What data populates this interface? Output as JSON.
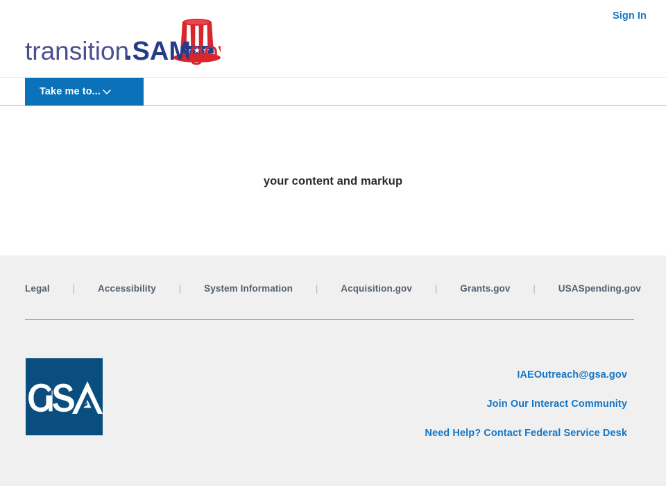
{
  "colors": {
    "brand_blue": "#0b71b9",
    "link_blue": "#1476c6",
    "logo_navy": "#3f4a99",
    "logo_red": "#d8262c",
    "gsa_navy": "#0a4e7f",
    "footer_bg": "#f0f0f0",
    "footer_link": "#55606e"
  },
  "header": {
    "signin_label": "Sign In",
    "logo": {
      "alt": "transition.SAM.gov",
      "text_part1": "transition",
      "text_part2": ".SAM",
      "text_part3": ".gov",
      "icon_name": "uncle-sam-top-hat-icon",
      "hat_stars": 3
    }
  },
  "nav": {
    "take_me_to_label": "Take me to...",
    "chevron": "⌄"
  },
  "main": {
    "content_text": "your content and markup"
  },
  "footer": {
    "links": [
      {
        "label": "Legal"
      },
      {
        "label": "Accessibility"
      },
      {
        "label": "System Information"
      },
      {
        "label": "Acquisition.gov"
      },
      {
        "label": "Grants.gov"
      },
      {
        "label": "USASpending.gov"
      }
    ],
    "separator": "|",
    "gsa_logo_text": "GSA",
    "contact_links": [
      {
        "label": "IAEOutreach@gsa.gov"
      },
      {
        "label": "Join Our Interact Community"
      },
      {
        "label": "Need Help? Contact Federal Service Desk"
      }
    ]
  }
}
